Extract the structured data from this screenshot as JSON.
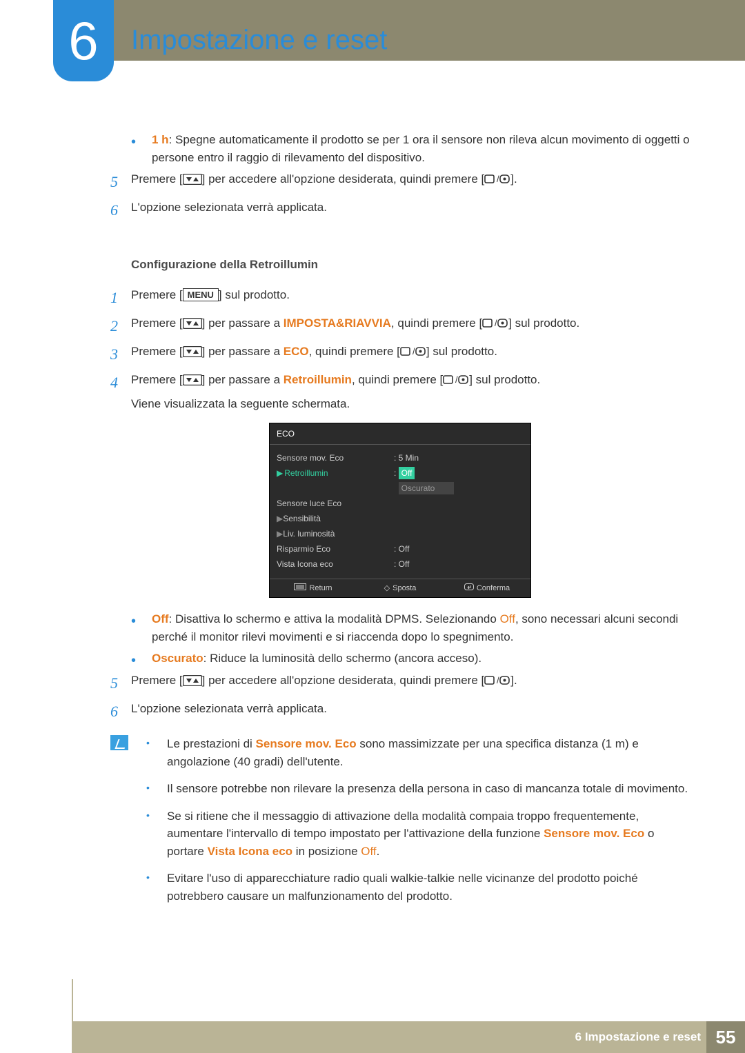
{
  "chapter": {
    "number": "6",
    "title": "Impostazione e reset"
  },
  "sec1": {
    "bullet1_label": "1 h",
    "bullet1_text": ": Spegne automaticamente il prodotto se per 1 ora il sensore non rileva alcun movimento di oggetti o persone entro il raggio di rilevamento del dispositivo.",
    "step5_a": "Premere [",
    "step5_b": "] per accedere all'opzione desiderata, quindi premere [",
    "step5_c": "].",
    "step6": "L'opzione selezionata verrà applicata."
  },
  "sec2": {
    "heading": "Configurazione della Retroillumin",
    "step1_a": "Premere [",
    "step1_menu": "MENU",
    "step1_b": "] sul prodotto.",
    "step2_a": "Premere [",
    "step2_b": "] per passare a ",
    "step2_target": "IMPOSTA&RIAVVIA",
    "step2_c": ", quindi premere [",
    "step2_d": "] sul prodotto.",
    "step3_a": "Premere [",
    "step3_b": "] per passare a ",
    "step3_target": "ECO",
    "step3_c": ", quindi premere [",
    "step3_d": "] sul prodotto.",
    "step4_a": "Premere [",
    "step4_b": "] per passare a ",
    "step4_target": "Retroillumin",
    "step4_c": ", quindi premere [",
    "step4_d": "] sul prodotto.",
    "step4_e": "Viene visualizzata la seguente schermata."
  },
  "osd": {
    "title": "ECO",
    "rows": [
      {
        "l": "Sensore mov. Eco",
        "r": ":  5 Min",
        "hl": false
      },
      {
        "l": "Retroillumin",
        "r": "Off",
        "hl": true,
        "below": "Oscurato"
      },
      {
        "l": "Sensore luce Eco",
        "r": "",
        "hl": false
      },
      {
        "l": "Sensibilità",
        "r": "",
        "hl": false,
        "arrow": true
      },
      {
        "l": "Liv. luminosità",
        "r": "",
        "hl": false,
        "arrow": true
      },
      {
        "l": "Risparmio Eco",
        "r": ":  Off",
        "hl": false
      },
      {
        "l": "Vista Icona eco",
        "r": ":  Off",
        "hl": false
      }
    ],
    "footer": {
      "return": "Return",
      "move": "Sposta",
      "enter": "Conferma"
    }
  },
  "sec3": {
    "b1_label": "Off",
    "b1_text_a": ": Disattiva lo schermo e attiva la modalità DPMS. Selezionando ",
    "b1_off2": "Off",
    "b1_text_b": ", sono necessari alcuni secondi perché il monitor rilevi movimenti e si riaccenda dopo lo spegnimento.",
    "b2_label": "Oscurato",
    "b2_text": ": Riduce la luminosità dello schermo (ancora acceso).",
    "step5_a": "Premere [",
    "step5_b": "] per accedere all'opzione desiderata, quindi premere [",
    "step5_c": "].",
    "step6": "L'opzione selezionata verrà applicata."
  },
  "notes": {
    "n1_a": "Le prestazioni di ",
    "n1_hl": "Sensore mov. Eco",
    "n1_b": " sono massimizzate per una specifica distanza (1 m) e angolazione (40 gradi) dell'utente.",
    "n2": "Il sensore potrebbe non rilevare la presenza della persona in caso di mancanza totale di movimento.",
    "n3_a": "Se si ritiene che il messaggio di attivazione della modalità compaia troppo frequentemente, aumentare l'intervallo di tempo impostato per l'attivazione della funzione ",
    "n3_hl1": "Sensore mov. Eco",
    "n3_b": " o portare ",
    "n3_hl2": "Vista Icona eco",
    "n3_c": " in posizione ",
    "n3_hl3": "Off",
    "n3_d": ".",
    "n4": "Evitare l'uso di apparecchiature radio quali walkie-talkie nelle vicinanze del prodotto poiché potrebbero causare un malfunzionamento del prodotto."
  },
  "footer": {
    "title": "6 Impostazione e reset",
    "page": "55"
  }
}
